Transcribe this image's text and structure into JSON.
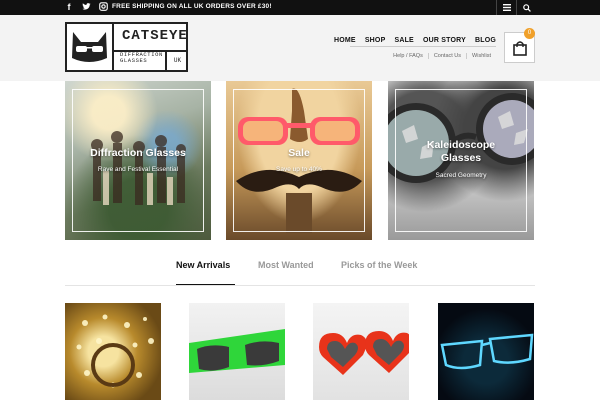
{
  "topbar": {
    "promo": "FREE SHIPPING ON ALL UK ORDERS OVER £30!",
    "social": [
      "facebook-icon",
      "twitter-icon",
      "instagram-icon"
    ],
    "right_icons": [
      "menu-icon",
      "search-icon"
    ]
  },
  "logo": {
    "brand": "CATSEYE",
    "subtitle_line1": "DIFFRACTION",
    "subtitle_line2": "GLASSES",
    "region": "UK"
  },
  "nav": {
    "main": [
      "HOME",
      "SHOP",
      "SALE",
      "OUR STORY",
      "BLOG"
    ],
    "sub": [
      "Help / FAQs",
      "Contact Us",
      "Wishlist"
    ]
  },
  "cart": {
    "count": "0"
  },
  "banners": [
    {
      "title": "Diffraction Glasses",
      "caption": "Rave and Festival Essential"
    },
    {
      "title": "Sale",
      "caption": "Save up to 40%"
    },
    {
      "title": "Kaleidoscope Glasses",
      "caption": "Sacred Geometry"
    }
  ],
  "tabs": [
    "New Arrivals",
    "Most Wanted",
    "Picks of the Week"
  ],
  "colors": {
    "accent": "#f0a02a",
    "topbar": "#111111",
    "header_bg": "#f3f3f3"
  }
}
